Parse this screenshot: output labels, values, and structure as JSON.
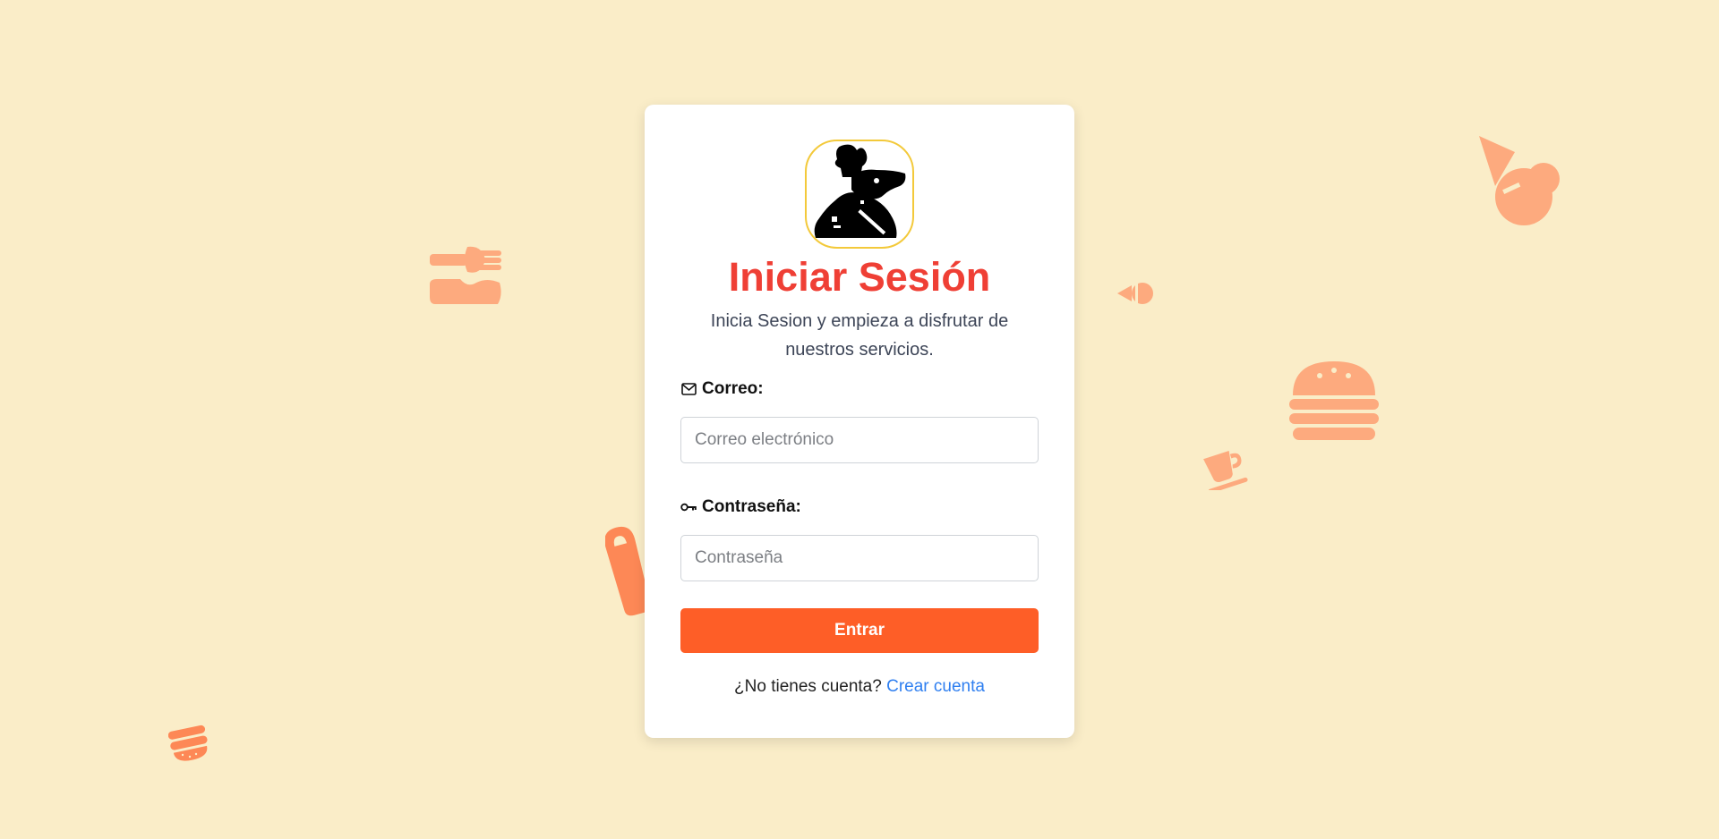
{
  "colors": {
    "background": "#faedc8",
    "accent": "#fe5e27",
    "title": "#ef3f35",
    "link": "#2f7ff0",
    "decoration": "#fdaa7e",
    "decoration_dark": "#fd8856",
    "logo_border": "#f3c93a"
  },
  "decorations": [
    "fork-knife-icon",
    "ice-cream-icon",
    "candy-icon",
    "burger-icon",
    "coffee-cup-icon",
    "popsicle-icon",
    "macaron-icon"
  ],
  "logo": {
    "icon": "chef-rat-logo-icon"
  },
  "login": {
    "title": "Iniciar Sesión",
    "subtitle": "Inicia Sesion y empieza a disfrutar de nuestros servicios.",
    "email": {
      "icon": "envelope-icon",
      "label": "Correo:",
      "placeholder": "Correo electrónico",
      "value": ""
    },
    "password": {
      "icon": "key-icon",
      "label": "Contraseña:",
      "placeholder": "Contraseña",
      "value": ""
    },
    "submit_label": "Entrar",
    "signup_prompt": "¿No tienes cuenta?",
    "signup_link": "Crear cuenta"
  }
}
